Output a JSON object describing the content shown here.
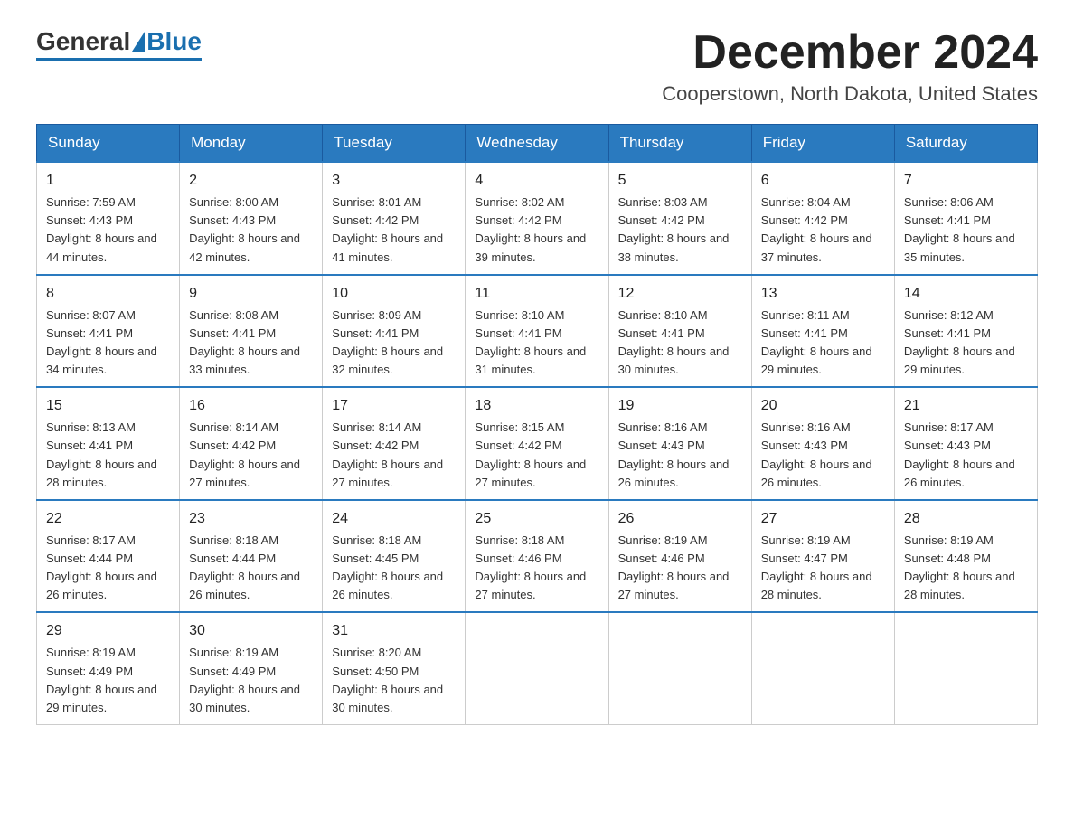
{
  "logo": {
    "general": "General",
    "blue": "Blue"
  },
  "title": {
    "month_year": "December 2024",
    "location": "Cooperstown, North Dakota, United States"
  },
  "headers": [
    "Sunday",
    "Monday",
    "Tuesday",
    "Wednesday",
    "Thursday",
    "Friday",
    "Saturday"
  ],
  "weeks": [
    [
      {
        "day": "1",
        "sunrise": "7:59 AM",
        "sunset": "4:43 PM",
        "daylight": "8 hours and 44 minutes."
      },
      {
        "day": "2",
        "sunrise": "8:00 AM",
        "sunset": "4:43 PM",
        "daylight": "8 hours and 42 minutes."
      },
      {
        "day": "3",
        "sunrise": "8:01 AM",
        "sunset": "4:42 PM",
        "daylight": "8 hours and 41 minutes."
      },
      {
        "day": "4",
        "sunrise": "8:02 AM",
        "sunset": "4:42 PM",
        "daylight": "8 hours and 39 minutes."
      },
      {
        "day": "5",
        "sunrise": "8:03 AM",
        "sunset": "4:42 PM",
        "daylight": "8 hours and 38 minutes."
      },
      {
        "day": "6",
        "sunrise": "8:04 AM",
        "sunset": "4:42 PM",
        "daylight": "8 hours and 37 minutes."
      },
      {
        "day": "7",
        "sunrise": "8:06 AM",
        "sunset": "4:41 PM",
        "daylight": "8 hours and 35 minutes."
      }
    ],
    [
      {
        "day": "8",
        "sunrise": "8:07 AM",
        "sunset": "4:41 PM",
        "daylight": "8 hours and 34 minutes."
      },
      {
        "day": "9",
        "sunrise": "8:08 AM",
        "sunset": "4:41 PM",
        "daylight": "8 hours and 33 minutes."
      },
      {
        "day": "10",
        "sunrise": "8:09 AM",
        "sunset": "4:41 PM",
        "daylight": "8 hours and 32 minutes."
      },
      {
        "day": "11",
        "sunrise": "8:10 AM",
        "sunset": "4:41 PM",
        "daylight": "8 hours and 31 minutes."
      },
      {
        "day": "12",
        "sunrise": "8:10 AM",
        "sunset": "4:41 PM",
        "daylight": "8 hours and 30 minutes."
      },
      {
        "day": "13",
        "sunrise": "8:11 AM",
        "sunset": "4:41 PM",
        "daylight": "8 hours and 29 minutes."
      },
      {
        "day": "14",
        "sunrise": "8:12 AM",
        "sunset": "4:41 PM",
        "daylight": "8 hours and 29 minutes."
      }
    ],
    [
      {
        "day": "15",
        "sunrise": "8:13 AM",
        "sunset": "4:41 PM",
        "daylight": "8 hours and 28 minutes."
      },
      {
        "day": "16",
        "sunrise": "8:14 AM",
        "sunset": "4:42 PM",
        "daylight": "8 hours and 27 minutes."
      },
      {
        "day": "17",
        "sunrise": "8:14 AM",
        "sunset": "4:42 PM",
        "daylight": "8 hours and 27 minutes."
      },
      {
        "day": "18",
        "sunrise": "8:15 AM",
        "sunset": "4:42 PM",
        "daylight": "8 hours and 27 minutes."
      },
      {
        "day": "19",
        "sunrise": "8:16 AM",
        "sunset": "4:43 PM",
        "daylight": "8 hours and 26 minutes."
      },
      {
        "day": "20",
        "sunrise": "8:16 AM",
        "sunset": "4:43 PM",
        "daylight": "8 hours and 26 minutes."
      },
      {
        "day": "21",
        "sunrise": "8:17 AM",
        "sunset": "4:43 PM",
        "daylight": "8 hours and 26 minutes."
      }
    ],
    [
      {
        "day": "22",
        "sunrise": "8:17 AM",
        "sunset": "4:44 PM",
        "daylight": "8 hours and 26 minutes."
      },
      {
        "day": "23",
        "sunrise": "8:18 AM",
        "sunset": "4:44 PM",
        "daylight": "8 hours and 26 minutes."
      },
      {
        "day": "24",
        "sunrise": "8:18 AM",
        "sunset": "4:45 PM",
        "daylight": "8 hours and 26 minutes."
      },
      {
        "day": "25",
        "sunrise": "8:18 AM",
        "sunset": "4:46 PM",
        "daylight": "8 hours and 27 minutes."
      },
      {
        "day": "26",
        "sunrise": "8:19 AM",
        "sunset": "4:46 PM",
        "daylight": "8 hours and 27 minutes."
      },
      {
        "day": "27",
        "sunrise": "8:19 AM",
        "sunset": "4:47 PM",
        "daylight": "8 hours and 28 minutes."
      },
      {
        "day": "28",
        "sunrise": "8:19 AM",
        "sunset": "4:48 PM",
        "daylight": "8 hours and 28 minutes."
      }
    ],
    [
      {
        "day": "29",
        "sunrise": "8:19 AM",
        "sunset": "4:49 PM",
        "daylight": "8 hours and 29 minutes."
      },
      {
        "day": "30",
        "sunrise": "8:19 AM",
        "sunset": "4:49 PM",
        "daylight": "8 hours and 30 minutes."
      },
      {
        "day": "31",
        "sunrise": "8:20 AM",
        "sunset": "4:50 PM",
        "daylight": "8 hours and 30 minutes."
      },
      null,
      null,
      null,
      null
    ]
  ]
}
